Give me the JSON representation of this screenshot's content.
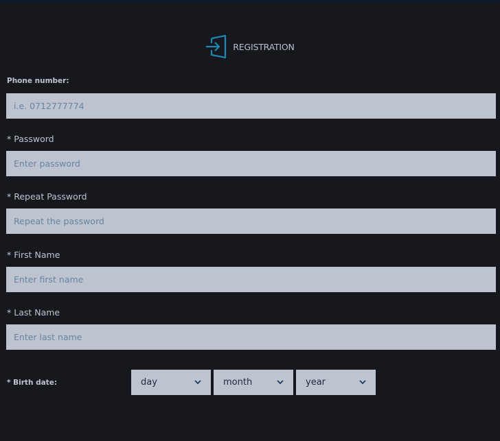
{
  "header": {
    "title": "REGISTRATION",
    "icon": "sign-in-icon",
    "accent_color": "#1e87b4"
  },
  "form": {
    "phone": {
      "label": "Phone number:",
      "placeholder": "i.e. 0712777774"
    },
    "password": {
      "label": "* Password",
      "placeholder": "Enter password"
    },
    "repeat_password": {
      "label": "* Repeat Password",
      "placeholder": "Repeat the password"
    },
    "first_name": {
      "label": "* First Name",
      "placeholder": "Enter first name"
    },
    "last_name": {
      "label": "* Last Name",
      "placeholder": "Enter last name"
    },
    "birth_date": {
      "label": "* Birth date:",
      "day": "day",
      "month": "month",
      "year": "year"
    }
  },
  "colors": {
    "background": "#16181e",
    "input_background": "#bdc3cf",
    "placeholder": "#6784a3"
  }
}
